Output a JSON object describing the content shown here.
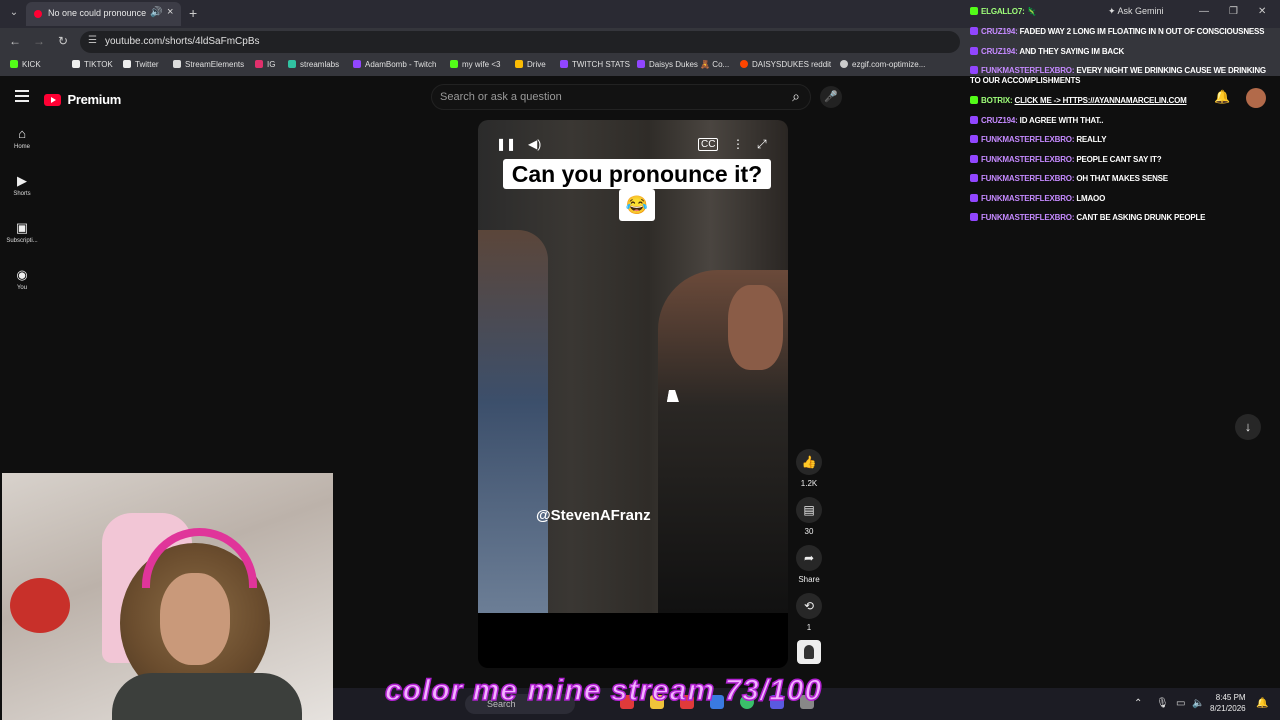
{
  "browser": {
    "tab_title": "No one could pronounce t",
    "url": "youtube.com/shorts/4ldSaFmCpBs",
    "ask_gemini": "Ask Gemini",
    "bookmarks": [
      "KICK",
      "TIKTOK",
      "Twitter",
      "StreamElements",
      "IG",
      "streamlabs",
      "AdamBomb - Twitch",
      "my wife <3",
      "Drive",
      "TWITCH STATS",
      "Daisys Dukes 🧸 Co...",
      "DAISYSDUKES reddit",
      "ezgif.com-optimize..."
    ]
  },
  "youtube": {
    "logo_text": "Premium",
    "search_placeholder": "Search or ask a question",
    "rail": [
      {
        "label": "Home",
        "icon": "⌂"
      },
      {
        "label": "Shorts",
        "icon": "▶"
      },
      {
        "label": "Subscripti...",
        "icon": "▣"
      },
      {
        "label": "You",
        "icon": "◉"
      }
    ]
  },
  "short": {
    "caption": "Can you pronounce it?",
    "emoji": "😂",
    "handle": "@StevenAFranz",
    "likes": "1.2K",
    "comments": "30",
    "share_label": "Share",
    "remix_count": "1"
  },
  "chat": [
    {
      "user": "elgallo7:",
      "msg": "🦎",
      "platform": "kick"
    },
    {
      "user": "cruz194:",
      "msg": "faded way 2 long im floating in n out of consciousness",
      "platform": "twitch"
    },
    {
      "user": "cruz194:",
      "msg": "and they saying im back",
      "platform": "twitch"
    },
    {
      "user": "funkmasterflexbro:",
      "msg": "every night we drinking cause we drinking to our accomplishments",
      "platform": "twitch"
    },
    {
      "user": "botrix:",
      "msg": "click me -> https://ayannamarcelin.com",
      "platform": "kick",
      "link": true
    },
    {
      "user": "cruz194:",
      "msg": "id agree with that..",
      "platform": "twitch"
    },
    {
      "user": "funkmasterflexbro:",
      "msg": "really",
      "platform": "twitch"
    },
    {
      "user": "funkmasterflexbro:",
      "msg": "people cant say it?",
      "platform": "twitch"
    },
    {
      "user": "funkmasterflexbro:",
      "msg": "oh that makes sense",
      "platform": "twitch"
    },
    {
      "user": "funkmasterflexbro:",
      "msg": "lmaoo",
      "platform": "twitch"
    },
    {
      "user": "funkmasterflexbro:",
      "msg": "cant be asking drunk people",
      "platform": "twitch"
    }
  ],
  "overlay": "color me mine stream 73/100",
  "taskbar": {
    "search": "Search",
    "time": "8:45 PM",
    "date": "8/21/2026"
  }
}
